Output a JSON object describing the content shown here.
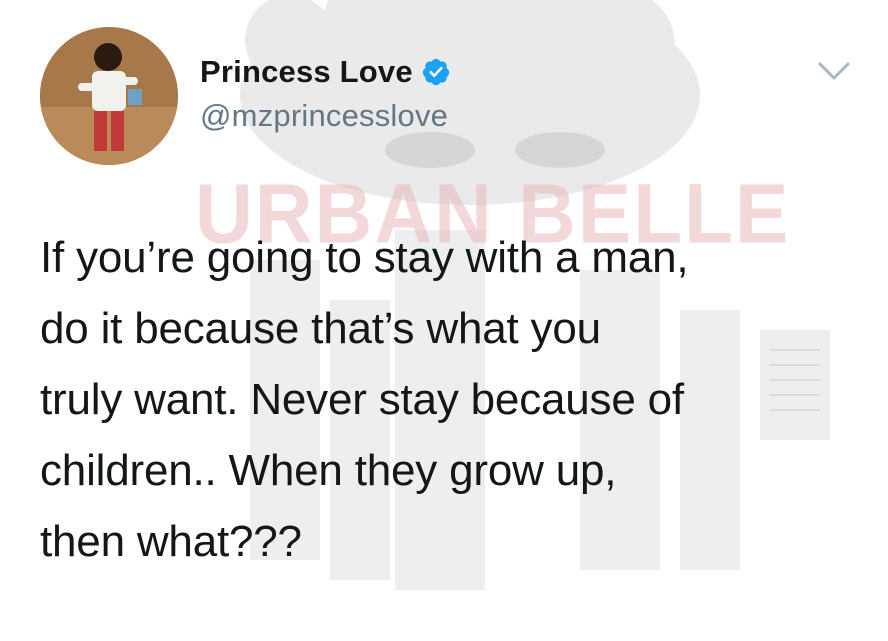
{
  "tweet": {
    "display_name": "Princess Love",
    "handle": "@mzprincesslove",
    "verified": true,
    "text": "If you’re going to stay with a man,\ndo it because that’s what you\ntruly want. Never stay because of\nchildren.. When they grow up,\nthen what???"
  },
  "watermark": {
    "text": "URBAN BELLE"
  },
  "icons": {
    "verified": "verified-badge-icon",
    "menu": "chevron-down-icon"
  },
  "colors": {
    "verified_blue": "#1da1f2",
    "name_text": "#14171a",
    "handle_text": "#657786",
    "watermark_pink": "#e8b9b9"
  }
}
